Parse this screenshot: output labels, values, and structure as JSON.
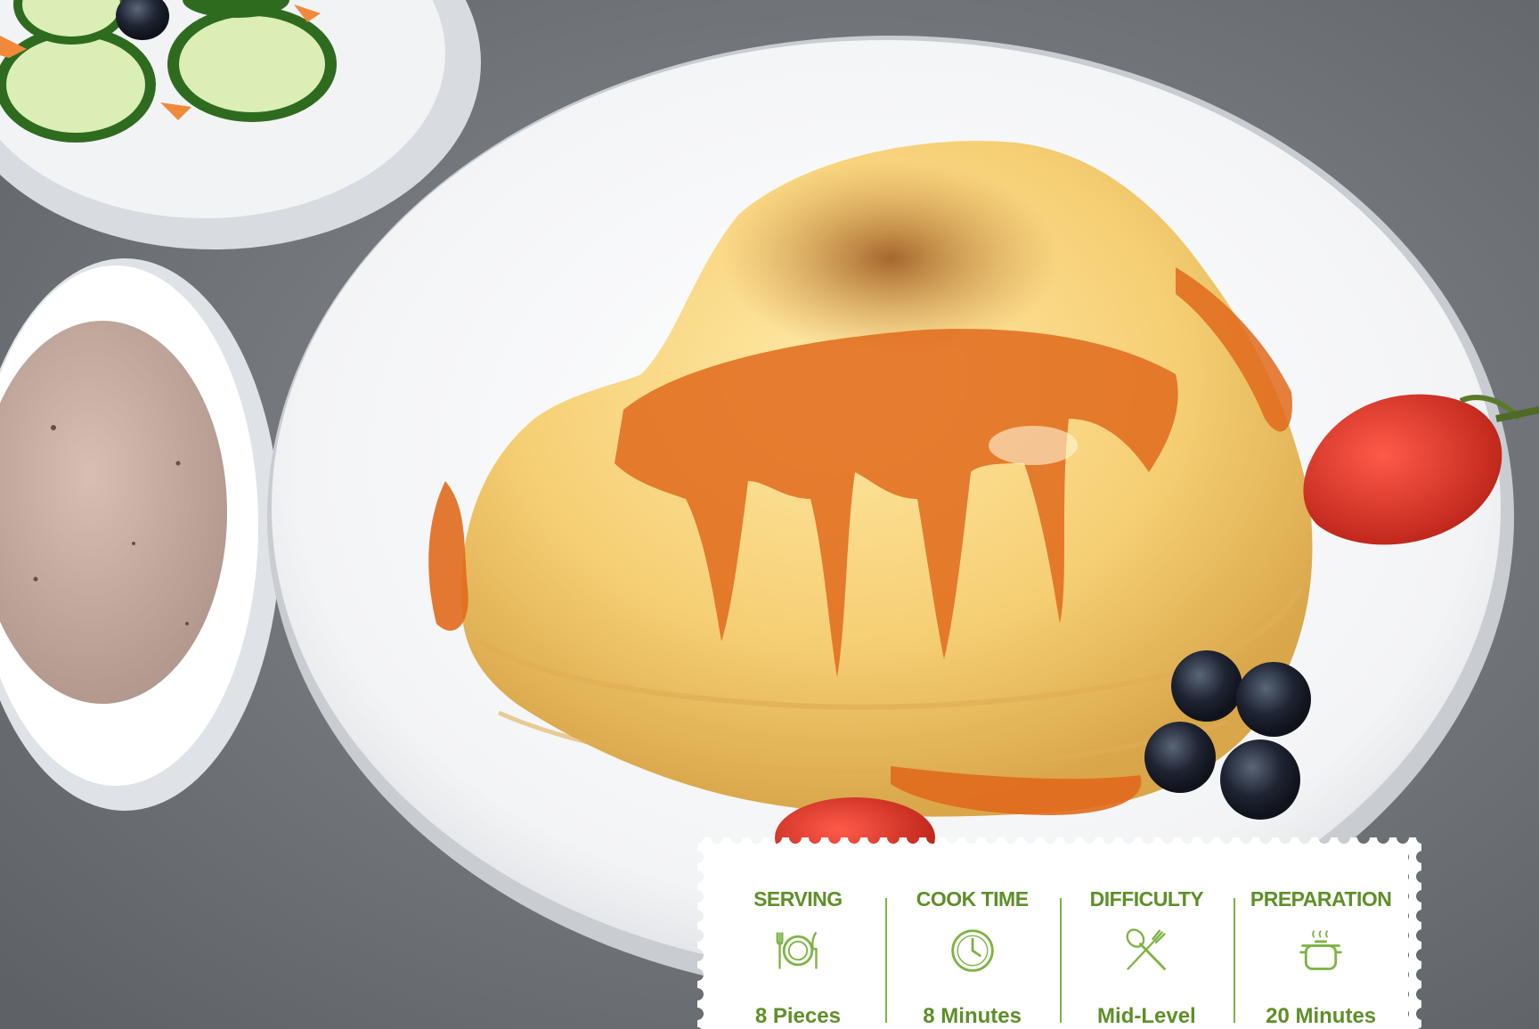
{
  "photo": {
    "subject": "pancakes-with-syrup-and-fruit"
  },
  "recipe_info": {
    "serving": {
      "label": "SERVING",
      "value": "8 Pieces",
      "icon": "plate-cutlery-icon"
    },
    "cook_time": {
      "label": "COOK TIME",
      "value": "8 Minutes",
      "icon": "clock-icon"
    },
    "difficulty": {
      "label": "DIFFICULTY",
      "value": "Mid-Level",
      "icon": "crossed-utensils-icon"
    },
    "preparation": {
      "label": "PREPARATION",
      "value": "20 Minutes",
      "icon": "steaming-pot-icon"
    }
  },
  "colors": {
    "accent": "#5e8f28",
    "divider": "#7cb342",
    "card": "#ffffff"
  }
}
